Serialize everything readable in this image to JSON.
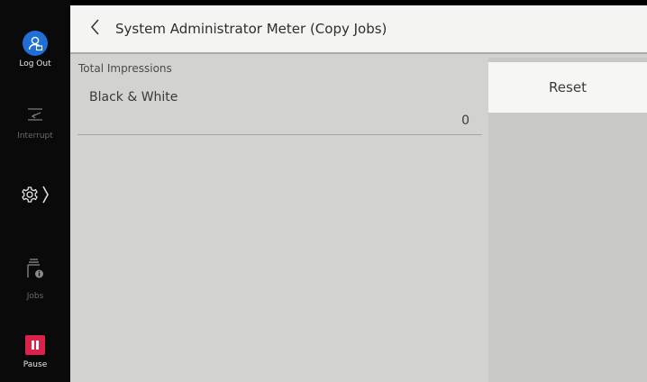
{
  "sidebar": {
    "logout_label": "Log Out",
    "interrupt_label": "Interrupt",
    "jobs_label": "Jobs",
    "pause_label": "Pause",
    "colors": {
      "logout_bg": "#1f6fd6",
      "pause_bg": "#d9234b"
    }
  },
  "header": {
    "title": "System Administrator Meter (Copy Jobs)"
  },
  "meter": {
    "section_label": "Total Impressions",
    "items": [
      {
        "name": "Black & White",
        "value": "0"
      }
    ]
  },
  "actions": {
    "reset_label": "Reset"
  }
}
